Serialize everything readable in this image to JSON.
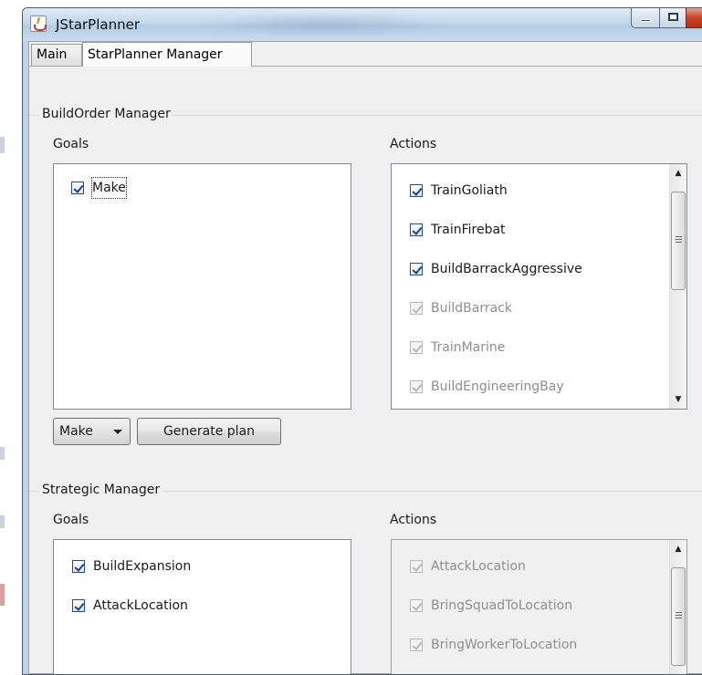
{
  "window": {
    "title": "JStarPlanner"
  },
  "tabs": [
    {
      "label": "Main"
    },
    {
      "label": "StarPlanner Manager",
      "selected": true
    }
  ],
  "build_order": {
    "title": "BuildOrder Manager",
    "goals_label": "Goals",
    "actions_label": "Actions",
    "goals": [
      {
        "label": "Make",
        "checked": true,
        "enabled": true
      }
    ],
    "actions": [
      {
        "label": "TrainGoliath",
        "checked": true,
        "enabled": true
      },
      {
        "label": "TrainFirebat",
        "checked": true,
        "enabled": true
      },
      {
        "label": "BuildBarrackAggressive",
        "checked": true,
        "enabled": true
      },
      {
        "label": "BuildBarrack",
        "checked": true,
        "enabled": false
      },
      {
        "label": "TrainMarine",
        "checked": true,
        "enabled": false
      },
      {
        "label": "BuildEngineeringBay",
        "checked": true,
        "enabled": false
      }
    ],
    "goal_select": {
      "value": "Make"
    },
    "generate_button": "Generate plan"
  },
  "strategic": {
    "title": "Strategic Manager",
    "goals_label": "Goals",
    "actions_label": "Actions",
    "goals": [
      {
        "label": "BuildExpansion",
        "checked": true,
        "enabled": true
      },
      {
        "label": "AttackLocation",
        "checked": true,
        "enabled": true
      }
    ],
    "actions": [
      {
        "label": "AttackLocation",
        "checked": true,
        "enabled": false
      },
      {
        "label": "BringSquadToLocation",
        "checked": true,
        "enabled": false
      },
      {
        "label": "BringWorkerToLocation",
        "checked": true,
        "enabled": false
      }
    ]
  },
  "icons": {
    "app": "java-cup-icon",
    "minimize": "minimize-icon",
    "maximize": "maximize-icon",
    "close": "close-icon",
    "scroll_up": "scroll-up-arrow-icon",
    "scroll_down": "scroll-down-arrow-icon",
    "dropdown": "chevron-down-icon"
  },
  "colors": {
    "title_bar": "#c4d7ec",
    "panel": "#f0f0f0",
    "close_button": "#c9432a",
    "checkbox_mark": "#1f3f8a"
  }
}
